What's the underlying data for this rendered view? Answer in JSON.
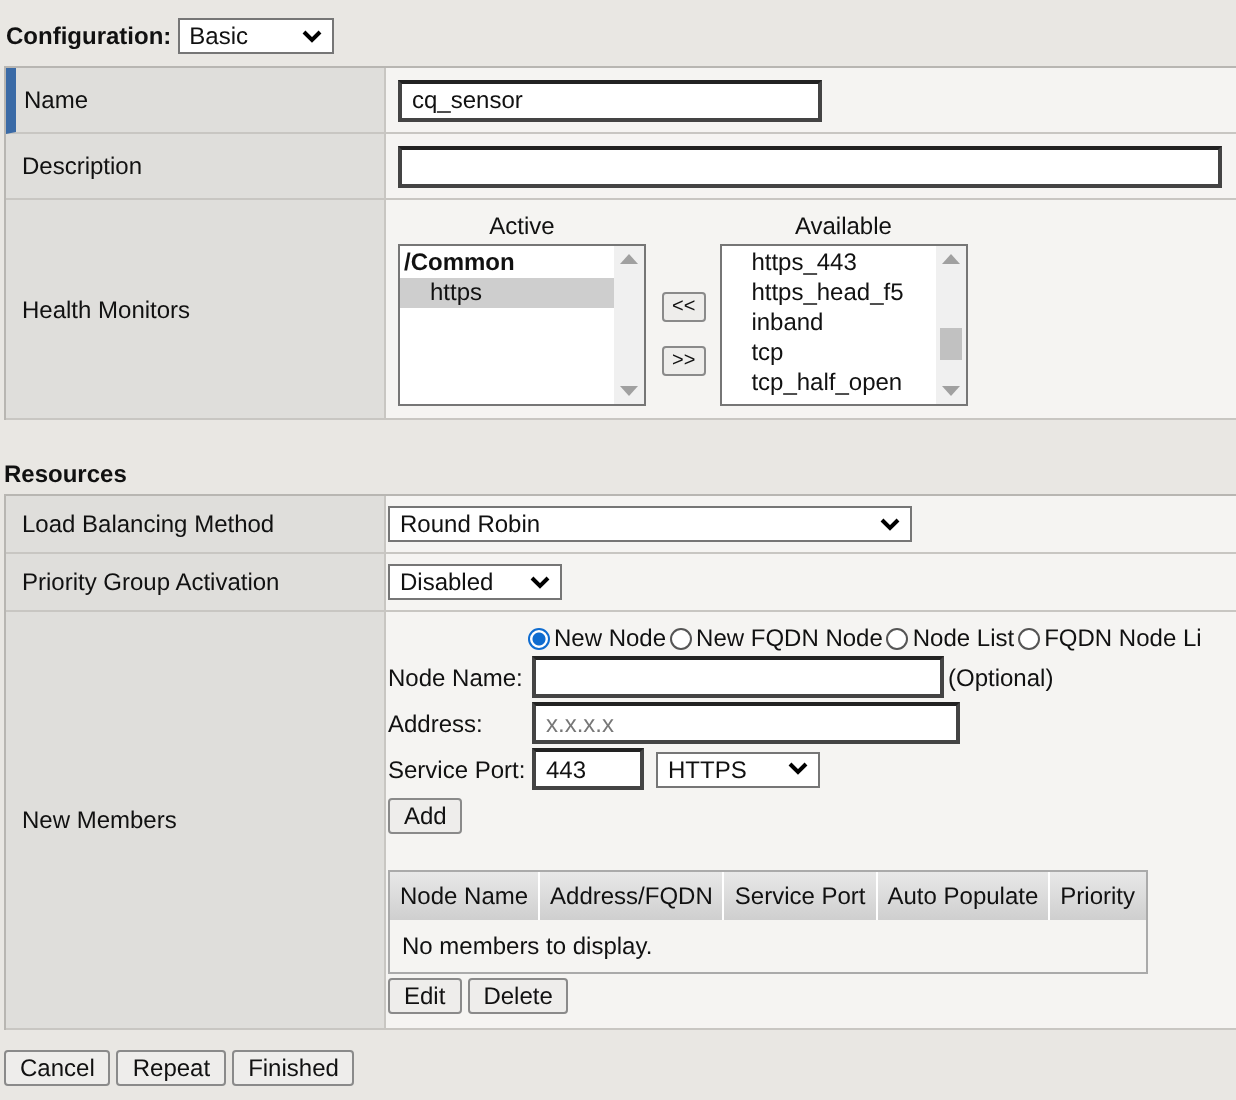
{
  "configuration": {
    "label": "Configuration:",
    "value": "Basic"
  },
  "general": {
    "name": {
      "label": "Name",
      "value": "cq_sensor"
    },
    "description": {
      "label": "Description"
    },
    "health_monitors": {
      "label": "Health Monitors",
      "active": {
        "title": "Active",
        "items": [
          {
            "text": "/Common",
            "kind": "group",
            "selected": false
          },
          {
            "text": "https",
            "kind": "item",
            "selected": true
          }
        ]
      },
      "move_left": "<<",
      "move_right": ">>",
      "available": {
        "title": "Available",
        "items": [
          {
            "text": "https_443",
            "kind": "item",
            "selected": false
          },
          {
            "text": "https_head_f5",
            "kind": "item",
            "selected": false
          },
          {
            "text": "inband",
            "kind": "item",
            "selected": false
          },
          {
            "text": "tcp",
            "kind": "item",
            "selected": false
          },
          {
            "text": "tcp_half_open",
            "kind": "item",
            "selected": false
          }
        ]
      }
    }
  },
  "resources": {
    "title": "Resources",
    "load_balancing": {
      "label": "Load Balancing Method",
      "value": "Round Robin"
    },
    "priority_group": {
      "label": "Priority Group Activation",
      "value": "Disabled"
    },
    "new_members": {
      "label": "New Members",
      "radios": [
        {
          "label": "New Node",
          "selected": true
        },
        {
          "label": "New FQDN Node",
          "selected": false
        },
        {
          "label": "Node List",
          "selected": false
        },
        {
          "label": "FQDN Node Li",
          "selected": false
        }
      ],
      "node_name": {
        "label": "Node Name:",
        "note": "(Optional)"
      },
      "address": {
        "label": "Address:",
        "placeholder": "x.x.x.x"
      },
      "service_port": {
        "label": "Service Port:",
        "value": "443",
        "protocol": "HTTPS"
      },
      "add": "Add",
      "table": {
        "columns": [
          "Node Name",
          "Address/FQDN",
          "Service Port",
          "Auto Populate",
          "Priority"
        ],
        "empty": "No members to display."
      },
      "buttons": [
        "Edit",
        "Delete"
      ]
    }
  },
  "footer_buttons": [
    "Cancel",
    "Repeat",
    "Finished"
  ]
}
